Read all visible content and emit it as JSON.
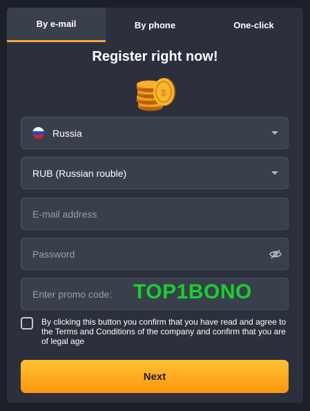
{
  "tabs": [
    {
      "label": "By e-mail"
    },
    {
      "label": "By phone"
    },
    {
      "label": "One-click"
    }
  ],
  "title": "Register right now!",
  "country": {
    "value": "Russia",
    "icon": "russia-flag-icon"
  },
  "currency": {
    "value": "RUB (Russian rouble)"
  },
  "email": {
    "placeholder": "E-mail address"
  },
  "password": {
    "placeholder": "Password",
    "icon": "eye-slash-icon"
  },
  "promo": {
    "placeholder": "Enter promo code:",
    "code": "TOP1BONO"
  },
  "terms": {
    "text": "By clicking this button you confirm that you have read and agree to the Terms and Conditions of the company and confirm that you are of legal age",
    "checked": false
  },
  "next": {
    "label": "Next"
  },
  "colors": {
    "accent": "#f7a53a",
    "button": "#ff9f1a",
    "promo": "#17d12e",
    "panel": "#2b303c",
    "field": "#3a3f4c"
  }
}
